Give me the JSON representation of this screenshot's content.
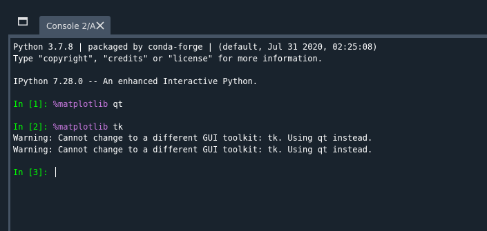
{
  "tab": {
    "title": "Console 2/A",
    "close_icon": "close-icon",
    "window_icon": "window-icon"
  },
  "colors": {
    "background": "#19232d",
    "tab_bg": "#455364",
    "text": "#ffffff",
    "prompt": "#00ff00",
    "magic": "#c678dd"
  },
  "console": {
    "banner_line1": "Python 3.7.8 | packaged by conda-forge | (default, Jul 31 2020, 02:25:08)",
    "banner_line2": "Type \"copyright\", \"credits\" or \"license\" for more information.",
    "ipython_line": "IPython 7.28.0 -- An enhanced Interactive Python.",
    "in1_prompt": "In [1]: ",
    "in1_magic": "%matplotlib",
    "in1_arg": " qt",
    "in2_prompt": "In [2]: ",
    "in2_magic": "%matplotlib",
    "in2_arg": " tk",
    "warning1": "Warning: Cannot change to a different GUI toolkit: tk. Using qt instead.",
    "warning2": "Warning: Cannot change to a different GUI toolkit: tk. Using qt instead.",
    "in3_prompt": "In [3]: "
  }
}
